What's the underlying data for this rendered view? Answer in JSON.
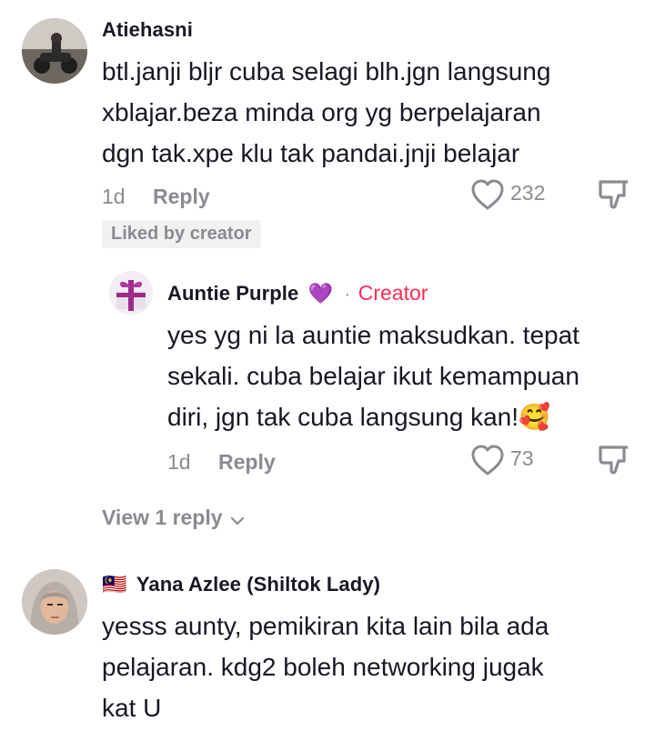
{
  "comments": [
    {
      "username": "Atiehasni",
      "text_lines": [
        "btl.janji bljr cuba selagi blh.jgn langsung",
        "xblajar.beza minda org yg berpelajaran",
        "dgn tak.xpe klu tak pandai.jnji belajar"
      ],
      "time": "1d",
      "reply_label": "Reply",
      "likes": "232",
      "badge": "Liked by creator",
      "avatar_icon": "avatar-motorcycle-photo"
    },
    {
      "username": "Auntie Purple",
      "username_emoji": "💜",
      "separator": "·",
      "creator_label": "Creator",
      "text_lines": [
        "yes yg ni la auntie maksudkan. tepat",
        "sekali. cuba belajar ikut kemampuan",
        "diri, jgn tak cuba langsung kan!🥰"
      ],
      "time": "1d",
      "reply_label": "Reply",
      "likes": "73",
      "avatar_icon": "avatar-purple-gift-photo"
    },
    {
      "flag": "🇲🇾",
      "username": "Yana Azlee (Shiltok Lady)",
      "text_lines": [
        "yesss aunty, pemikiran kita lain bila ada",
        "pelajaran. kdg2 boleh networking jugak",
        "kat U"
      ],
      "avatar_icon": "avatar-hijab-photo"
    }
  ],
  "view_replies_label": "View 1 reply",
  "colors": {
    "accent": "#fe2c55",
    "muted": "#8a8b91",
    "text": "#161823"
  },
  "icons": {
    "like": "heart-outline-icon",
    "dislike": "thumbs-down-icon",
    "chevron": "chevron-down-icon"
  }
}
